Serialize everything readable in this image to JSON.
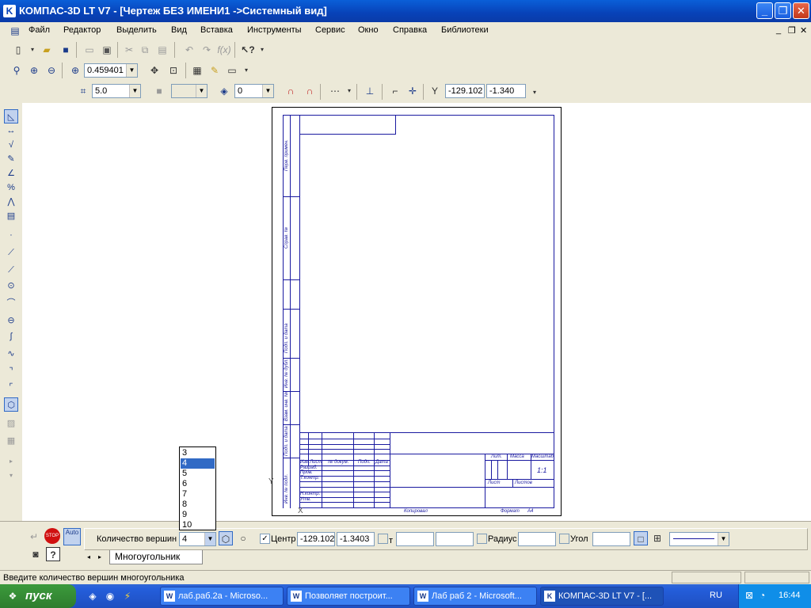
{
  "window": {
    "title": "КОМПАС-3D LT V7 - [Чертеж БЕЗ ИМЕНИ1 ->Системный вид]",
    "minimize": "_",
    "maximize": "❐",
    "close": "✕"
  },
  "menu": {
    "items": [
      "Файл",
      "Редактор",
      "Выделить",
      "Вид",
      "Вставка",
      "Инструменты",
      "Сервис",
      "Окно",
      "Справка",
      "Библиотеки"
    ]
  },
  "toolbar2": {
    "zoom_value": "0.459401"
  },
  "toolbar3": {
    "step_value": "5.0",
    "layer_value": "0",
    "coord_x": "-129.102",
    "coord_y": "-1.340"
  },
  "drawing": {
    "stamp_labels": {
      "perv_primen": "Перв. примен.",
      "sprav": "Справ. №",
      "podp_data1": "Подп. и дата",
      "inv_dubl": "Инв. № дубл.",
      "vzam_inv": "Взам. инв. №",
      "podp_data2": "Подп. и дата",
      "inv_podl": "Инв. № подл.",
      "izm": "Изм",
      "list": "Лист",
      "n_dokum": "№ докум.",
      "podp": "Подп.",
      "data": "Дата",
      "razrab": "Разраб.",
      "prov": "Пров.",
      "t_kontr": "Т.контр.",
      "n_kontr": "Н.контр.",
      "utv": "Утв.",
      "lit": "Лит.",
      "massa": "Масса",
      "masshtab": "Масштаб",
      "list2": "Лист",
      "listov": "Листов",
      "scale_value": "1:1",
      "kopiroval": "Копировал",
      "format": "Формат",
      "format_value": "А4"
    }
  },
  "dropdown": {
    "options": [
      "3",
      "4",
      "5",
      "6",
      "7",
      "8",
      "9",
      "10"
    ],
    "selected_index": 1
  },
  "propbar": {
    "vertex_count_label": "Количество вершин",
    "vertex_count_value": "4",
    "center_label": "Центр",
    "center_checked": true,
    "center_x": "-129.102",
    "center_y": "-1.3403",
    "t_label": "т",
    "radius_label": "Радиус",
    "angle_label": "Угол",
    "tab_label": "Многоугольник",
    "auto_label": "Auto",
    "stop_label": "STOP"
  },
  "status": {
    "message": "Введите количество вершин многоугольника"
  },
  "taskbar": {
    "start_label": "пуск",
    "tasks": [
      {
        "label": "лаб.раб.2а - Microso...",
        "icon": "W",
        "active": false
      },
      {
        "label": "Позволяет построит...",
        "icon": "W",
        "active": false
      },
      {
        "label": "Лаб раб 2 - Microsoft...",
        "icon": "W",
        "active": false
      },
      {
        "label": "КОМПАС-3D LT V7 - [...",
        "icon": "K",
        "active": true
      }
    ],
    "lang": "RU",
    "time": "16:44"
  },
  "colors": {
    "title_bar": "#0842b8",
    "drawing_lines": "#1a1aa0",
    "selection": "#316ac5"
  }
}
